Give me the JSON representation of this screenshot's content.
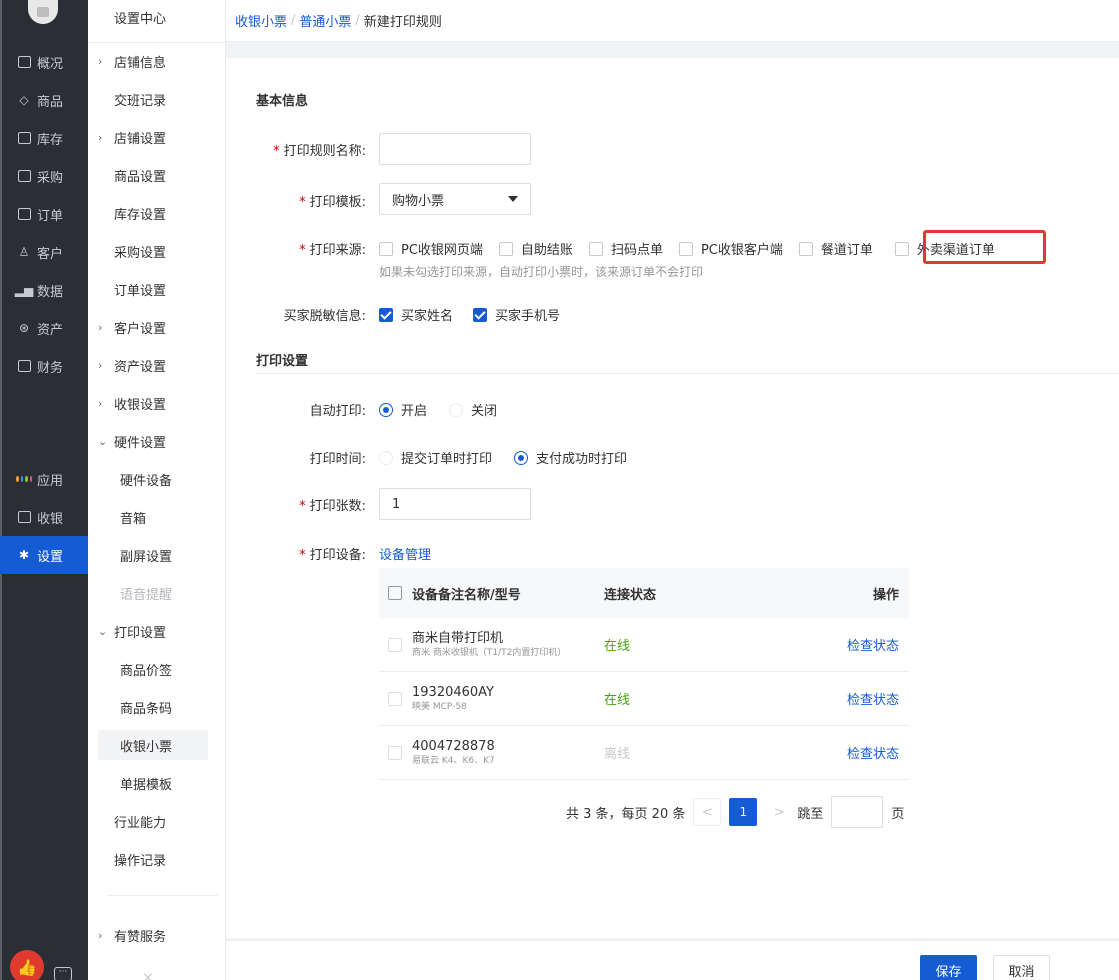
{
  "rail": {
    "items": [
      {
        "label": "概况",
        "icon": "monitor-icon"
      },
      {
        "label": "商品",
        "icon": "tag-icon"
      },
      {
        "label": "库存",
        "icon": "warehouse-icon"
      },
      {
        "label": "采购",
        "icon": "purchase-icon"
      },
      {
        "label": "订单",
        "icon": "order-icon"
      },
      {
        "label": "客户",
        "icon": "user-icon"
      },
      {
        "label": "数据",
        "icon": "chart-icon"
      },
      {
        "label": "资产",
        "icon": "yen-icon"
      },
      {
        "label": "财务",
        "icon": "finance-icon"
      },
      {
        "label": "应用",
        "icon": "apps-icon"
      },
      {
        "label": "收银",
        "icon": "cashier-icon"
      },
      {
        "label": "设置",
        "icon": "gear-icon"
      }
    ],
    "chat_icon_text": "···"
  },
  "sidebar": {
    "title": "设置中心",
    "items": [
      {
        "label": "店铺信息"
      },
      {
        "label": "交班记录"
      },
      {
        "label": "店铺设置"
      },
      {
        "label": "商品设置"
      },
      {
        "label": "库存设置"
      },
      {
        "label": "采购设置"
      },
      {
        "label": "订单设置"
      },
      {
        "label": "客户设置"
      },
      {
        "label": "资产设置"
      },
      {
        "label": "收银设置"
      },
      {
        "label": "硬件设置"
      },
      {
        "label": "硬件设备"
      },
      {
        "label": "音箱"
      },
      {
        "label": "副屏设置"
      },
      {
        "label": "语音提醒"
      },
      {
        "label": "打印设置"
      },
      {
        "label": "商品价签"
      },
      {
        "label": "商品条码"
      },
      {
        "label": "收银小票"
      },
      {
        "label": "单据模板"
      },
      {
        "label": "行业能力"
      },
      {
        "label": "操作记录"
      },
      {
        "label": "有赞服务"
      }
    ],
    "close_glyph": "×"
  },
  "breadcrumb": {
    "items": [
      "收银小票",
      "普通小票",
      "新建打印规则"
    ],
    "separator": "/"
  },
  "basic": {
    "title": "基本信息",
    "rule_name_label": "打印规则名称:",
    "rule_name_value": "",
    "template_label": "打印模板:",
    "template_value": "购物小票",
    "source_label": "打印来源:",
    "sources": [
      "PC收银网页端",
      "自助结账",
      "扫码点单",
      "PC收银客户端",
      "餐道订单",
      "外卖渠道订单"
    ],
    "source_hint": "如果未勾选打印来源，自动打印小票时，该来源订单不会打印",
    "mask_label": "买家脱敏信息:",
    "mask_options": [
      "买家姓名",
      "买家手机号"
    ]
  },
  "print": {
    "title": "打印设置",
    "auto_label": "自动打印:",
    "auto_options": [
      "开启",
      "关闭"
    ],
    "time_label": "打印时间:",
    "time_options": [
      "提交订单时打印",
      "支付成功时打印"
    ],
    "copies_label": "打印张数:",
    "copies_value": "1",
    "device_label": "打印设备:",
    "device_link": "设备管理",
    "table": {
      "headers": [
        "设备备注名称/型号",
        "连接状态",
        "操作"
      ],
      "rows": [
        {
          "name": "商米自带打印机",
          "model": "商米 商米收银机（T1/T2内置打印机）",
          "status": "在线",
          "action": "检查状态"
        },
        {
          "name": "19320460AY",
          "model": "映美 MCP-58",
          "status": "在线",
          "action": "检查状态"
        },
        {
          "name": "4004728878",
          "model": "易联云 K4、K6、K7",
          "status": "离线",
          "action": "检查状态"
        }
      ]
    },
    "pager": {
      "summary": "共 3 条，每页 20 条",
      "current": "1",
      "jump_label": "跳至",
      "page_unit": "页",
      "prev": "<",
      "next": ">"
    }
  },
  "footer": {
    "save": "保存",
    "cancel": "取消"
  },
  "colors": {
    "primary": "#155bd4",
    "online": "#45a110",
    "highlight": "#e0392e",
    "rail_bg": "#2b2f35"
  }
}
